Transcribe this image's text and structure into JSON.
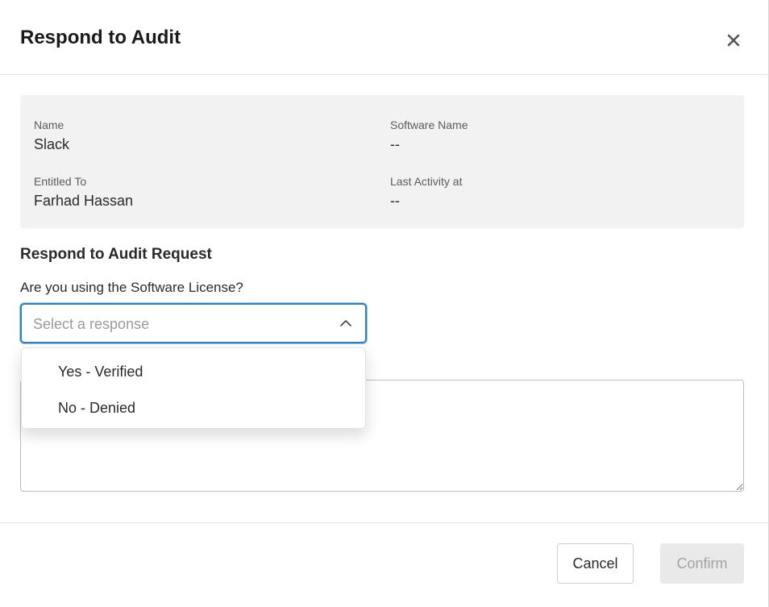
{
  "modal": {
    "title": "Respond to Audit",
    "close_icon": "close-icon"
  },
  "info": {
    "name_label": "Name",
    "name_value": "Slack",
    "software_name_label": "Software Name",
    "software_name_value": "--",
    "entitled_to_label": "Entitled To",
    "entitled_to_value": "Farhad Hassan",
    "last_activity_label": "Last Activity at",
    "last_activity_value": "--"
  },
  "form": {
    "section_title": "Respond to Audit Request",
    "question": "Are you using the Software License?",
    "select_placeholder": "Select a response",
    "select_icon": "chevron-up-icon",
    "options": [
      {
        "label": "Yes - Verified"
      },
      {
        "label": "No - Denied"
      }
    ]
  },
  "footer": {
    "cancel_label": "Cancel",
    "confirm_label": "Confirm"
  },
  "colors": {
    "focus_border": "#2f7fbf",
    "panel_bg": "#f2f2f2",
    "disabled_bg": "#e9e9e9"
  }
}
